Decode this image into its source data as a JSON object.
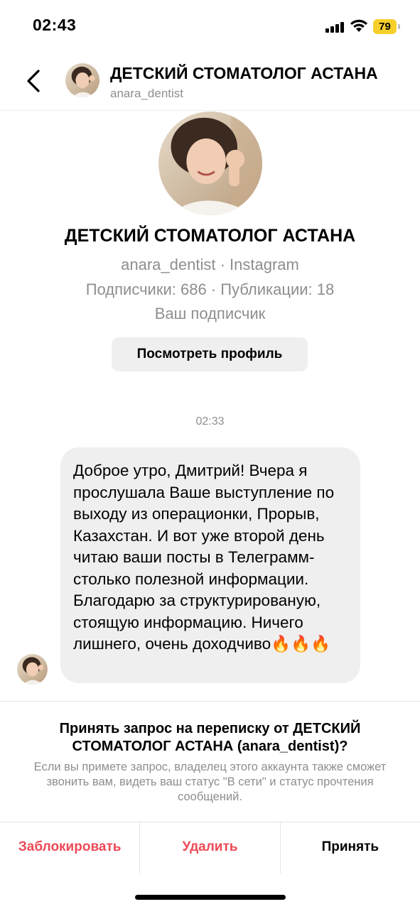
{
  "status_bar": {
    "time": "02:43",
    "battery_level": "79",
    "battery_color": "#f6cf2b",
    "icons": [
      "cellular-signal-icon",
      "wifi-icon",
      "battery-icon"
    ]
  },
  "header": {
    "back_icon": "chevron-left-icon",
    "name": "ДЕТСКИЙ СТОМАТОЛОГ АСТАНА",
    "username": "anara_dentist"
  },
  "profile": {
    "name": "ДЕТСКИЙ СТОМАТОЛОГ АСТАНА",
    "meta_line1": "anara_dentist · Instagram",
    "meta_line2": "Подписчики: 686 · Публикации: 18",
    "meta_line3": "Ваш подписчик",
    "view_profile_label": "Посмотреть профиль"
  },
  "conversation": {
    "timestamp": "02:33",
    "messages": [
      {
        "sender": "anara_dentist",
        "text": "Доброе утро, Дмитрий! Вчера я прослушала Ваше выступление по выходу из операционки, Прорыв, Казахстан. И вот уже второй день читаю ваши посты в Телеграмм- столько полезной информации. Благодарю за структурированую, стоящую информацию. Ничего лишнего, очень доходчиво🔥🔥🔥"
      }
    ]
  },
  "request": {
    "title": "Принять запрос на переписку от ДЕТСКИЙ СТОМАТОЛОГ АСТАНА (anara_dentist)?",
    "description": "Если вы примете запрос, владелец этого аккаунта также сможет звонить вам, видеть ваш статус \"В сети\" и статус прочтения сообщений.",
    "actions": {
      "block": "Заблокировать",
      "delete": "Удалить",
      "accept": "Принять"
    }
  },
  "colors": {
    "destructive": "#ed4956",
    "secondary_text": "#8e8e8e",
    "bubble_bg": "#efefef"
  }
}
